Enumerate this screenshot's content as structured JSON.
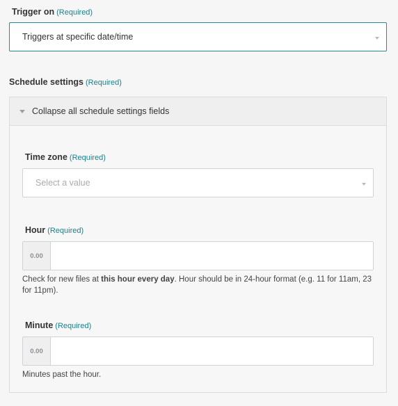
{
  "trigger": {
    "label": "Trigger on",
    "required": "(Required)",
    "value": "Triggers at specific date/time"
  },
  "schedule": {
    "label": "Schedule settings",
    "required": "(Required)",
    "collapse_label": "Collapse all schedule settings fields",
    "timezone": {
      "label": "Time zone",
      "required": "(Required)",
      "placeholder": "Select a value"
    },
    "hour": {
      "label": "Hour",
      "required": "(Required)",
      "prefix": "0.00",
      "value": "",
      "help_pre": "Check for new files at ",
      "help_bold": "this hour every day",
      "help_post": ". Hour should be in 24-hour format (e.g. 11 for 11am, 23 for 11pm)."
    },
    "minute": {
      "label": "Minute",
      "required": "(Required)",
      "prefix": "0.00",
      "value": "",
      "help": "Minutes past the hour."
    }
  }
}
